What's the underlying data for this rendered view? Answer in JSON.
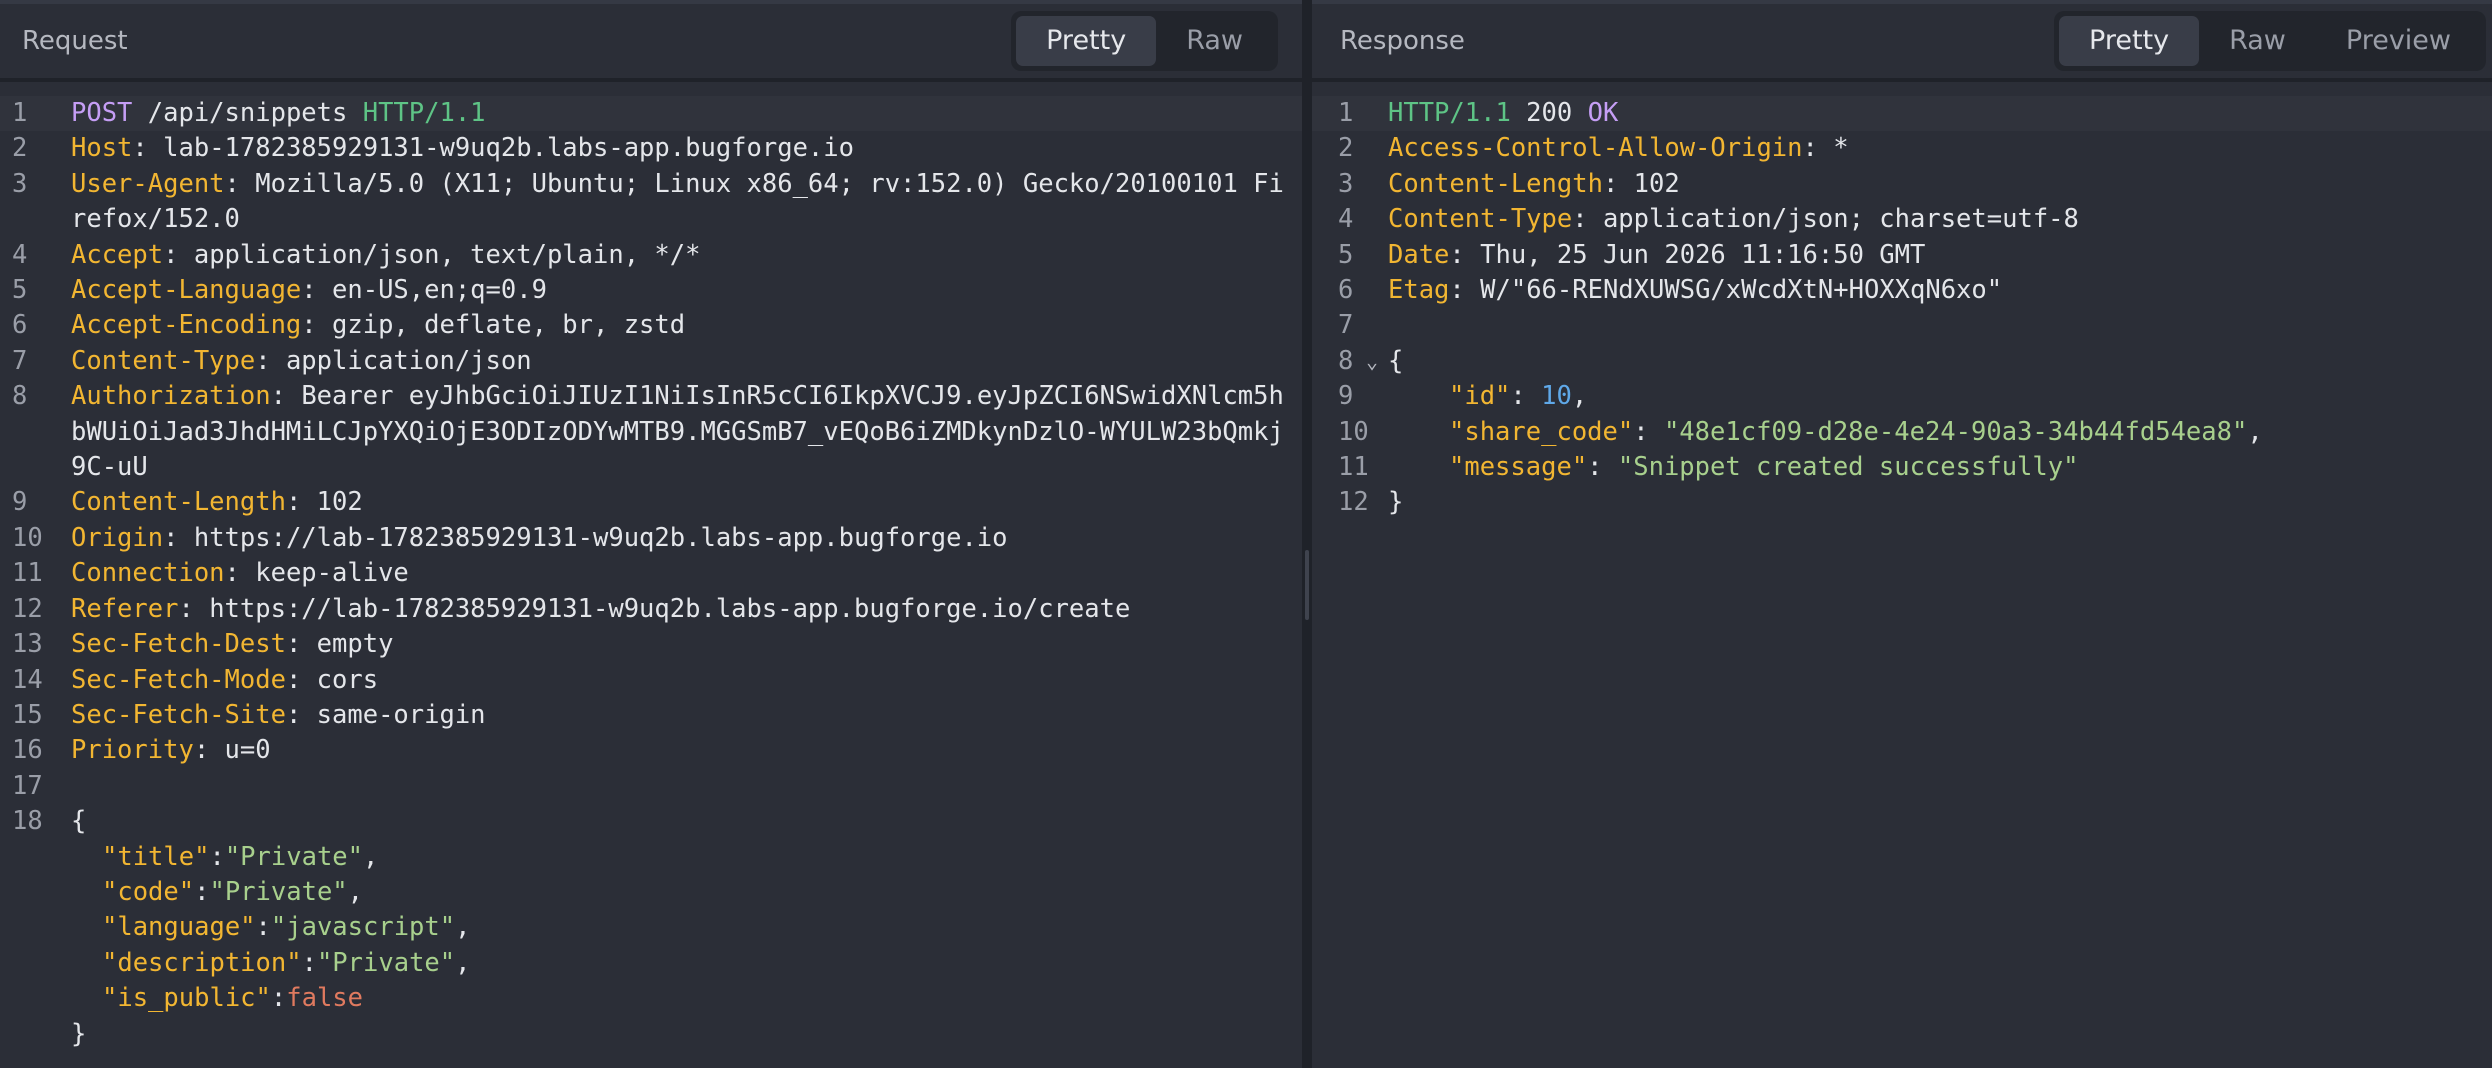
{
  "request": {
    "title": "Request",
    "tabs": [
      "Pretty",
      "Raw"
    ],
    "active_tab": "Pretty",
    "request_line": {
      "method": "POST",
      "path": " /api/snippets ",
      "protocol": "HTTP/1.1"
    },
    "headers": [
      {
        "line": "2",
        "name": "Host",
        "value": "lab-1782385929131-w9uq2b.labs-app.bugforge.io"
      },
      {
        "line": "3",
        "name": "User-Agent",
        "value": "Mozilla/5.0 (X11; Ubuntu; Linux x86_64; rv:152.0) Gecko/20100101 Firefox/152.0"
      },
      {
        "line": "4",
        "name": "Accept",
        "value": "application/json, text/plain, */*"
      },
      {
        "line": "5",
        "name": "Accept-Language",
        "value": "en-US,en;q=0.9"
      },
      {
        "line": "6",
        "name": "Accept-Encoding",
        "value": "gzip, deflate, br, zstd"
      },
      {
        "line": "7",
        "name": "Content-Type",
        "value": "application/json"
      },
      {
        "line": "8",
        "name": "Authorization",
        "value": "Bearer eyJhbGciOiJIUzI1NiIsInR5cCI6IkpXVCJ9.eyJpZCI6NSwidXNlcm5hbWUiOiJad3JhdHMiLCJpYXQiOjE3ODIzODYwMTB9.MGGSmB7_vEQoB6iZMDkynDzlO-WYULW23bQmkj9C-uU"
      },
      {
        "line": "9",
        "name": "Content-Length",
        "value": "102"
      },
      {
        "line": "10",
        "name": "Origin",
        "value": "https://lab-1782385929131-w9uq2b.labs-app.bugforge.io"
      },
      {
        "line": "11",
        "name": "Connection",
        "value": "keep-alive"
      },
      {
        "line": "12",
        "name": "Referer",
        "value": "https://lab-1782385929131-w9uq2b.labs-app.bugforge.io/create"
      },
      {
        "line": "13",
        "name": "Sec-Fetch-Dest",
        "value": "empty"
      },
      {
        "line": "14",
        "name": "Sec-Fetch-Mode",
        "value": "cors"
      },
      {
        "line": "15",
        "name": "Sec-Fetch-Site",
        "value": "same-origin"
      },
      {
        "line": "16",
        "name": "Priority",
        "value": "u=0"
      }
    ],
    "body": {
      "open": "{",
      "close": "}",
      "fields": [
        {
          "key": "\"title\"",
          "value": "\"Private\"",
          "type": "string",
          "comma": ","
        },
        {
          "key": "\"code\"",
          "value": "\"Private\"",
          "type": "string",
          "comma": ","
        },
        {
          "key": "\"language\"",
          "value": "\"javascript\"",
          "type": "string",
          "comma": ","
        },
        {
          "key": "\"description\"",
          "value": "\"Private\"",
          "type": "string",
          "comma": ","
        },
        {
          "key": "\"is_public\"",
          "value": "false",
          "type": "bool",
          "comma": ""
        }
      ]
    }
  },
  "response": {
    "title": "Response",
    "tabs": [
      "Pretty",
      "Raw",
      "Preview"
    ],
    "active_tab": "Pretty",
    "status_line": {
      "protocol": "HTTP/1.1",
      "code": " 200 ",
      "text": "OK"
    },
    "headers": [
      {
        "line": "2",
        "name": "Access-Control-Allow-Origin",
        "value": "*"
      },
      {
        "line": "3",
        "name": "Content-Length",
        "value": "102"
      },
      {
        "line": "4",
        "name": "Content-Type",
        "value": "application/json; charset=utf-8"
      },
      {
        "line": "5",
        "name": "Date",
        "value": "Thu, 25 Jun 2026 11:16:50 GMT"
      },
      {
        "line": "6",
        "name": "Etag",
        "value": "W/\"66-RENdXUWSG/xWcdXtN+HOXXqN6xo\""
      }
    ],
    "body": {
      "open": "{",
      "close": "}",
      "fields": [
        {
          "line": "9",
          "key": "\"id\"",
          "value": "10",
          "type": "number",
          "comma": ","
        },
        {
          "line": "10",
          "key": "\"share_code\"",
          "value": "\"48e1cf09-d28e-4e24-90a3-34b44fd54ea8\"",
          "type": "string",
          "comma": ","
        },
        {
          "line": "11",
          "key": "\"message\"",
          "value": "\"Snippet created successfully\"",
          "type": "string",
          "comma": ""
        }
      ]
    }
  },
  "icons": {
    "fold": "chevron-down-icon"
  }
}
